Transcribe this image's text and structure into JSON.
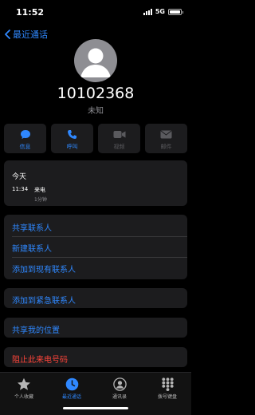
{
  "status_bar": {
    "time": "11:52",
    "network": "5G",
    "battery_level": 1.0
  },
  "nav": {
    "back_label": "最近通话"
  },
  "contact": {
    "number": "10102368",
    "label": "未知"
  },
  "actions": [
    {
      "label": "信息",
      "icon": "message-icon",
      "enabled": true
    },
    {
      "label": "呼叫",
      "icon": "phone-icon",
      "enabled": true
    },
    {
      "label": "视频",
      "icon": "video-icon",
      "enabled": false
    },
    {
      "label": "邮件",
      "icon": "mail-icon",
      "enabled": false
    }
  ],
  "recent": {
    "title": "今天",
    "time": "11:34",
    "type": "来电",
    "duration": "1分钟"
  },
  "contact_options": [
    "共享联系人",
    "新建联系人",
    "添加到现有联系人"
  ],
  "emergency": {
    "label": "添加到紧急联系人"
  },
  "location": {
    "label": "共享我的位置"
  },
  "block": {
    "label": "阻止此来电号码"
  },
  "tabs": [
    {
      "label": "个人收藏",
      "icon": "star-icon",
      "active": false
    },
    {
      "label": "最近通话",
      "icon": "clock-icon",
      "active": true
    },
    {
      "label": "通讯录",
      "icon": "contacts-icon",
      "active": false
    },
    {
      "label": "拨号键盘",
      "icon": "keypad-icon",
      "active": false
    }
  ],
  "colors": {
    "accent": "#2f88ff",
    "danger": "#ff453a",
    "card": "#1c1c1e",
    "background": "#000000"
  }
}
